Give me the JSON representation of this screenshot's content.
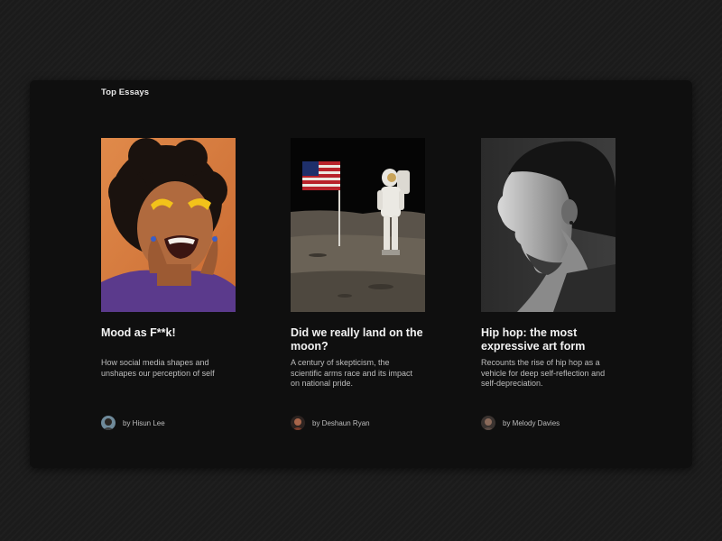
{
  "section": {
    "title": "Top Essays"
  },
  "cards": [
    {
      "title": "Mood as F**k!",
      "description": "How social media shapes and unshapes our perception of self",
      "author": "by Hisun Lee",
      "image": "woman-laughing-portrait"
    },
    {
      "title": "Did we really land on the moon?",
      "description": "A century of skepticism, the scientific arms race and its impact on national pride.",
      "author": "by Deshaun Ryan",
      "image": "astronaut-with-flag-on-moon"
    },
    {
      "title": "Hip hop: the most expressive art form",
      "description": "Recounts the rise of hip hop as a vehicle for deep self-reflection and self-depreciation.",
      "author": "by Melody Davies",
      "image": "man-profile-portrait"
    }
  ],
  "colors": {
    "page_background": "#1b1b1b",
    "panel_background": "#0f0f0f",
    "title_text": "#f2f2f2",
    "body_text": "#bdbdbd"
  }
}
